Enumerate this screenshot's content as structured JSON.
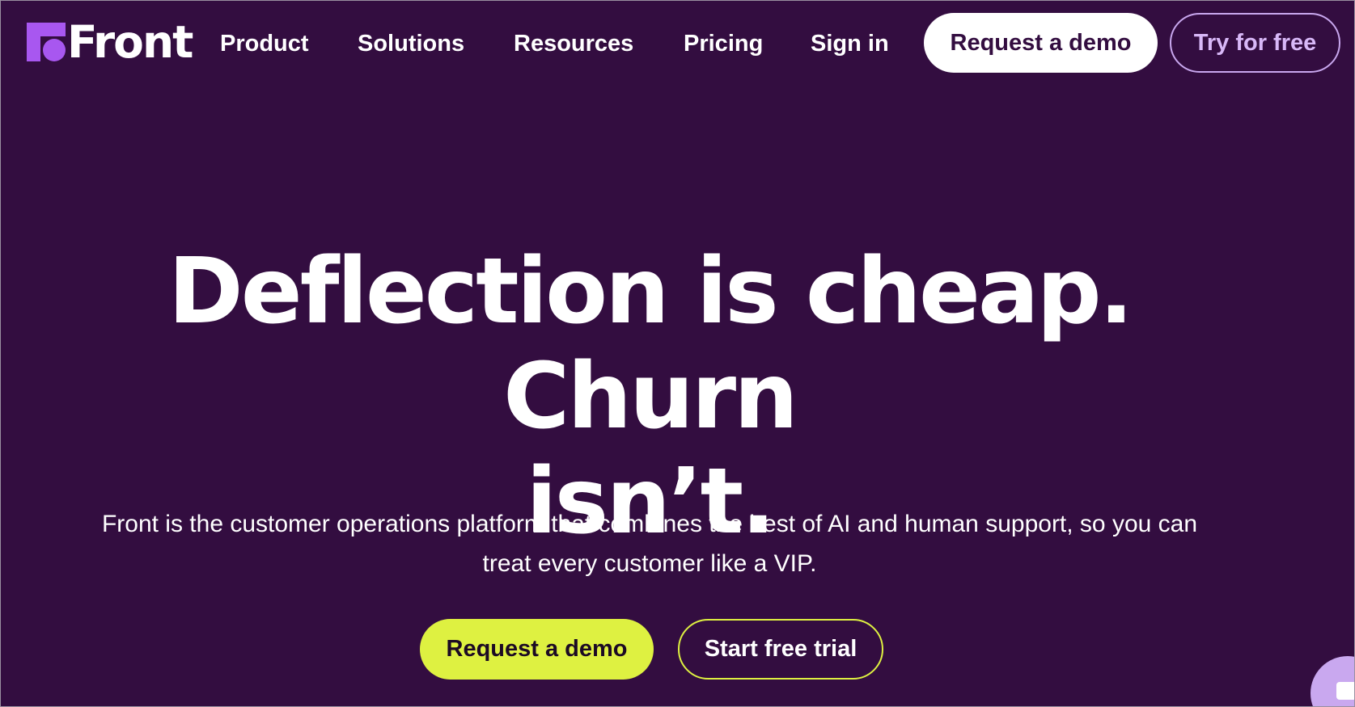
{
  "header": {
    "logo_text": "Front",
    "nav": [
      {
        "label": "Product"
      },
      {
        "label": "Solutions"
      },
      {
        "label": "Resources"
      },
      {
        "label": "Pricing"
      },
      {
        "label": "Sign in"
      }
    ],
    "request_demo_label": "Request a demo",
    "try_free_label": "Try for free"
  },
  "hero": {
    "title_line1": "Deflection is cheap. Churn",
    "title_line2": "isn’t.",
    "subtitle_line1": "Front is the customer operations platform that combines the best of AI and human support, so you can",
    "subtitle_line2": "treat every customer like a VIP.",
    "primary_cta": "Request a demo",
    "secondary_cta": "Start free trial"
  },
  "colors": {
    "background": "#330d40",
    "brand_purple": "#a857f0",
    "accent_lime": "#def141",
    "lavender": "#c9a8ef"
  },
  "icons": {
    "logo": "front-logo-icon",
    "chat": "chat-icon"
  }
}
